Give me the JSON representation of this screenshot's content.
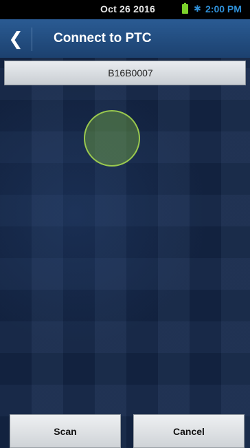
{
  "status_bar": {
    "date": "Oct 26 2016",
    "time": "2:00 PM",
    "battery_icon": "battery-icon",
    "bluetooth_icon": "bluetooth-icon",
    "accent_color": "#2f8fd6",
    "battery_color": "#7cd12b"
  },
  "header": {
    "back_glyph": "❮",
    "title": "Connect to PTC",
    "bar_color": "#244d80"
  },
  "devices": [
    {
      "label": "B16B0007"
    }
  ],
  "buttons": {
    "scan": "Scan",
    "cancel": "Cancel"
  }
}
